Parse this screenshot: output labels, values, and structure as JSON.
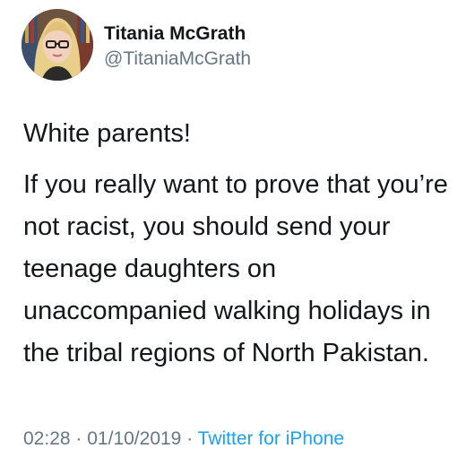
{
  "author": {
    "display_name": "Titania McGrath",
    "handle": "@TitaniaMcGrath",
    "avatar_icon": "profile-photo"
  },
  "tweet": {
    "first_line": "White parents!",
    "lines": [
      "If you really want to prove that you’re",
      "not racist, you should send your",
      "teenage daughters on",
      "unaccompanied walking holidays in",
      "the tribal regions of North Pakistan."
    ]
  },
  "meta": {
    "time": "02:28",
    "separator": "·",
    "date": "01/10/2019",
    "source": "Twitter for iPhone"
  },
  "colors": {
    "text": "#14171a",
    "secondary": "#657786",
    "link": "#1da1f2"
  }
}
